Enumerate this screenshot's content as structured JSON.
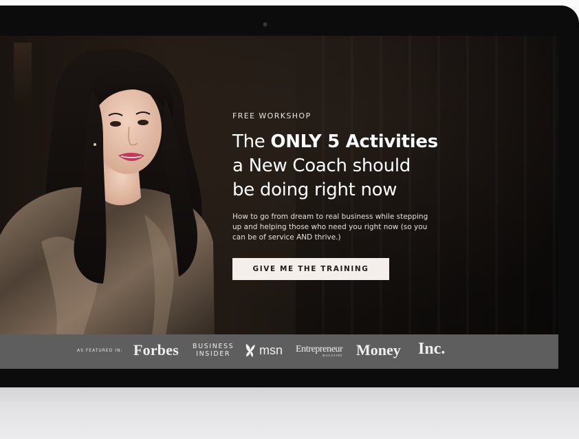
{
  "hero": {
    "eyebrow": "FREE WORKSHOP",
    "headline_prefix": "The ",
    "headline_bold": "ONLY 5 Activities",
    "headline_line2": "a New Coach should",
    "headline_line3": "be doing right now",
    "subcopy": "How to go from dream to real business while stepping up and helping those who need you right now (so you can be of service AND thrive.)",
    "cta_label": "GIVE ME THE TRAINING"
  },
  "featured": {
    "label": "AS FEATURED IN:",
    "logos": {
      "forbes": "Forbes",
      "business_line1": "BUSINESS",
      "business_line2": "INSIDER",
      "msn": "msn",
      "entrepreneur": "Entrepreneur",
      "entrepreneur_sub": "MAGAZINE",
      "money": "Money",
      "inc": "Inc."
    }
  },
  "colors": {
    "screen_bg": "#1a1410",
    "cta_bg": "#f5efec",
    "featured_bar": "#5e5e5e",
    "bezel": "#0c0c0c"
  },
  "icons": {
    "msn_logo": "butterfly-icon",
    "camera": "webcam-dot"
  }
}
